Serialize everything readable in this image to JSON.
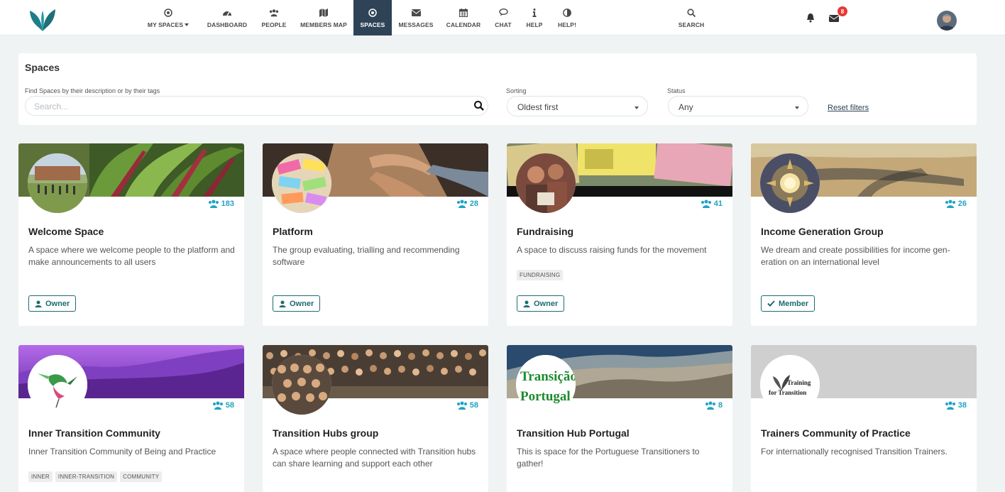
{
  "nav": {
    "items": [
      {
        "label": "My Spaces",
        "icon": "dot-circle-icon"
      },
      {
        "label": "Dashboard",
        "icon": "dashboard-icon"
      },
      {
        "label": "People",
        "icon": "users-icon"
      },
      {
        "label": "Members Map",
        "icon": "map-icon"
      },
      {
        "label": "Spaces",
        "icon": "dot-circle-icon"
      },
      {
        "label": "Messages",
        "icon": "envelope-icon"
      },
      {
        "label": "Calendar",
        "icon": "calendar-icon"
      },
      {
        "label": "Chat",
        "icon": "comment-icon"
      },
      {
        "label": "Help",
        "icon": "info-icon"
      },
      {
        "label": "Help!",
        "icon": "adjust-icon"
      },
      {
        "label": "Search",
        "icon": "search-icon"
      }
    ],
    "active": "Spaces",
    "message_count": "8"
  },
  "filters": {
    "title": "Spaces",
    "search_label": "Find Spaces by their description or by their tags",
    "search_placeholder": "Search...",
    "sorting_label": "Sorting",
    "sorting_value": "Oldest first",
    "status_label": "Status",
    "status_value": "Any",
    "reset_label": "Reset filters"
  },
  "spaces": [
    {
      "title": "Welcome Space",
      "desc": "A space where we welcome people to the platform and make announcements to all users",
      "members": "183",
      "tags": [],
      "role": "Owner"
    },
    {
      "title": "Platform",
      "desc": "The group evaluating, trialling and recommending software",
      "members": "28",
      "tags": [],
      "role": "Owner"
    },
    {
      "title": "Fundraising",
      "desc": "A space to discuss raising funds for the movement",
      "members": "41",
      "tags": [
        "FUNDRAISING"
      ],
      "role": "Owner"
    },
    {
      "title": "Income Generation Group",
      "desc": "We dream and create possibilities for income gen­eration on an international level",
      "members": "26",
      "tags": [],
      "role": "Member"
    },
    {
      "title": "Inner Transition Community",
      "desc": "Inner Transition Community of Being and Practice",
      "members": "58",
      "tags": [
        "INNER",
        "INNER-TRANSITION",
        "COMMUNITY"
      ],
      "role": ""
    },
    {
      "title": "Transition Hubs group",
      "desc": "A space where people connected with Transition hubs can share learning and support each other",
      "members": "58",
      "tags": [],
      "role": ""
    },
    {
      "title": "Transition Hub Portugal",
      "desc": "This is space for the Portuguese Transitioners to gather!",
      "members": "8",
      "tags": [],
      "role": ""
    },
    {
      "title": "Trainers Community of Practice",
      "desc": "For internationally recognised Transition Trainers.",
      "members": "38",
      "tags": [],
      "role": "",
      "avatar_text": [
        "Training",
        "for Transition"
      ]
    }
  ],
  "portugal_avatar_text": [
    "Transição",
    "Portugal"
  ],
  "colors": {
    "accent": "#1fa3c7",
    "brand": "#1c6b75",
    "nav_active": "#2e4356",
    "badge": "#e53935"
  }
}
